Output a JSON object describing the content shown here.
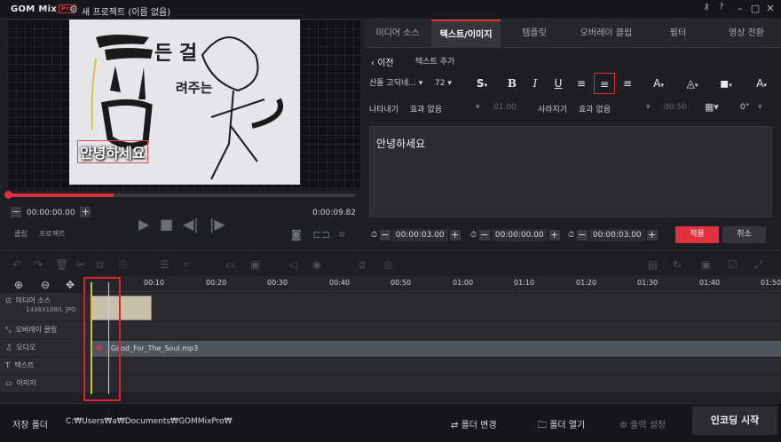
{
  "app": {
    "logo": "GOM Mix",
    "logo_badge": "Pro",
    "title": "새 프로젝트 (이름 없음)",
    "help": "?"
  },
  "preview": {
    "overlay_text": "안녕하세요",
    "time_current": "00:00:00.00",
    "time_total": "0:00:09.82",
    "tab_clip": "클립",
    "tab_project": "프로젝트"
  },
  "tabs": [
    "미디어 소스",
    "텍스트/이미지",
    "템플릿",
    "오버레이 클립",
    "필터",
    "영상 전환"
  ],
  "text_panel": {
    "back_label": "이전",
    "add_label": "텍스트 추가",
    "font": "산돌 고딕네...",
    "size": "72",
    "style_s": "S",
    "bold": "B",
    "italic": "I",
    "underline": "U",
    "appear_label": "나타내기",
    "appear_effect": "효과 없음",
    "appear_time": "01.00",
    "disappear_label": "사라지기",
    "disappear_effect": "효과 없음",
    "disappear_time": "00.50",
    "rotation": "0°",
    "content": "안녕하세요",
    "start_time": "00:00:03.00",
    "mid_time": "00:00:00.00",
    "end_time": "00:00:03.00",
    "apply": "적용",
    "cancel": "취소"
  },
  "timeline": {
    "ticks": [
      "00:10",
      "00:20",
      "00:30",
      "00:40",
      "00:50",
      "01:00",
      "01:10",
      "01:20",
      "01:30",
      "01:40",
      "01:50"
    ],
    "tracks": [
      {
        "label": "미디어 소스",
        "sub": "1436X1080, JPG",
        "icon": "image-icon"
      },
      {
        "label": "오버레이 클립",
        "icon": "overlay-icon"
      },
      {
        "label": "오디오",
        "icon": "music-icon"
      },
      {
        "label": "텍스트",
        "icon": "text-icon"
      },
      {
        "label": "이미지",
        "icon": "picture-icon"
      }
    ],
    "audio_file": "Good_For_The_Soul.mp3"
  },
  "bottom": {
    "save_folder_label": "저장 폴더",
    "save_path": "C:₩Users₩a₩Documents₩GOMMixPro₩",
    "change_folder": "폴더 변경",
    "open_folder": "폴더 열기",
    "output_settings": "출력 설정",
    "encode": "인코딩 시작"
  },
  "colors": {
    "accent": "#e0313e",
    "bg": "#1e1f23"
  }
}
